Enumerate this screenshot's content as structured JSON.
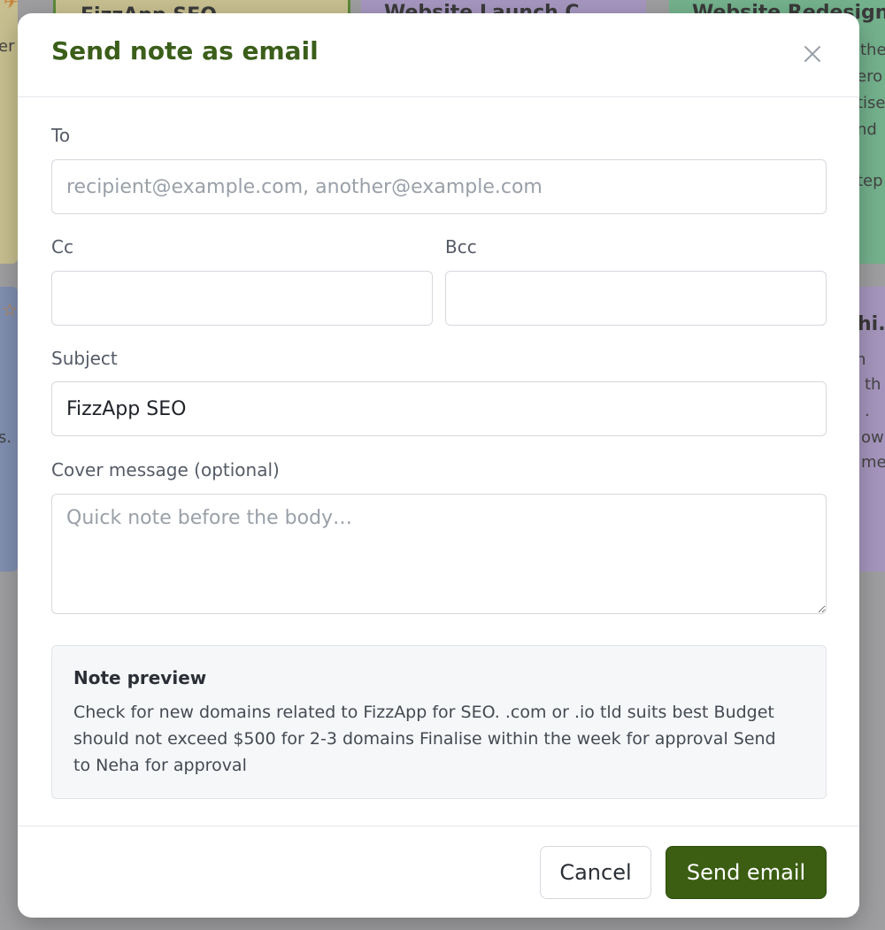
{
  "background": {
    "notes": [
      {
        "title": "FizzApp SEO"
      },
      {
        "title": "Website Launch C"
      },
      {
        "title": "Website Redesign."
      },
      {
        "title": "hi."
      }
    ],
    "right_fragments": [
      "the",
      "ero",
      "tise",
      "nd",
      "tep"
    ],
    "right_bottom_fragments": [
      "n",
      "th",
      ".",
      "ow",
      "me"
    ],
    "left_fragments": [
      "er",
      "s."
    ]
  },
  "modal": {
    "title": "Send note as email",
    "close_icon": "close-icon",
    "to": {
      "label": "To",
      "value": "",
      "placeholder": "recipient@example.com, another@example.com"
    },
    "cc": {
      "label": "Cc",
      "value": ""
    },
    "bcc": {
      "label": "Bcc",
      "value": ""
    },
    "subject": {
      "label": "Subject",
      "value": "FizzApp SEO"
    },
    "cover": {
      "label": "Cover message (optional)",
      "placeholder": "Quick note before the body…"
    },
    "preview": {
      "title": "Note preview",
      "body": "Check for new domains related to FizzApp for SEO. .com or .io tld suits best Budget should not exceed $500 for 2-3 domains Finalise within the week for approval Send to Neha for approval"
    },
    "buttons": {
      "cancel": "Cancel",
      "send": "Send email"
    }
  },
  "colors": {
    "accent": "#3b5e12",
    "title": "#3b5e1a"
  }
}
